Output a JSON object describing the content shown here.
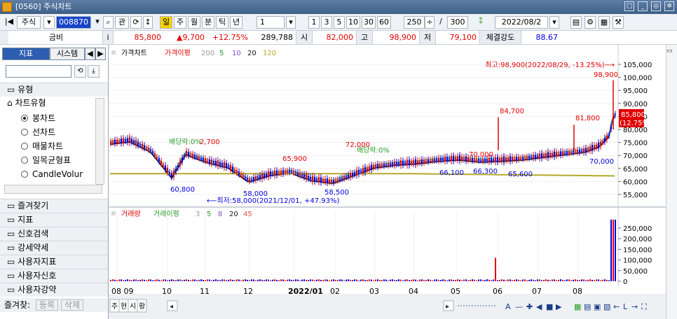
{
  "window": {
    "title": "[0560] 주식차트"
  },
  "toolbar": {
    "market": "주식",
    "code": "008870",
    "btn_gwan": "관",
    "btn_il": "일",
    "period_ju": "주",
    "period_wol": "월",
    "period_bun": "분",
    "period_tik": "틱",
    "period_nyeon": "년",
    "period_value": "1",
    "min_1": "1",
    "min_3": "3",
    "min_5": "5",
    "min_10": "10",
    "min_30": "30",
    "min_60": "60",
    "count": "250",
    "slash": "/",
    "total": "300",
    "date": "2022/08/2"
  },
  "quote": {
    "name": "금비",
    "price": "85,800",
    "change": "▲9,700",
    "change_pct": "+12.75%",
    "volume": "289,788",
    "open_label": "시",
    "open": "82,000",
    "high_label": "고",
    "high": "98,900",
    "low_label": "저",
    "low": "79,100",
    "strength_label": "체결강도",
    "strength": "88.67",
    "up_color": "#e00000",
    "down_color": "#0000e0"
  },
  "sidebar": {
    "tab_indicator": "지표",
    "tab_system": "시스템",
    "type_header": "유형",
    "chart_type_header": "차트유형",
    "chart_types": [
      "봉차트",
      "선차트",
      "매물차트",
      "일목균형표",
      "CandleVolur"
    ],
    "selected_index": 0,
    "groups": [
      "즐겨찾기",
      "지표",
      "신호검색",
      "강세약세",
      "사용자지표",
      "사용자신호",
      "사용자강약"
    ],
    "fav_label": "즐겨찾:",
    "fav_register": "등록",
    "fav_delete": "삭제"
  },
  "price_panel": {
    "legend_price": "가격차트",
    "legend_disparity": "가격이평",
    "legend_items": [
      "200",
      "5",
      "10",
      "20",
      "120"
    ],
    "legend_colors": [
      "#d9d9d9",
      "#2a9d2a",
      "#7d4ecf",
      "#111111",
      "#b5a82a"
    ],
    "y_ticks": [
      "105,000",
      "100,000",
      "95,000",
      "90,000",
      "85,000",
      "80,000",
      "75,000",
      "70,000",
      "65,000",
      "60,000",
      "55,000"
    ],
    "current_tag": "85,800",
    "current_tag_pct": "(12.75%)",
    "max_annotation": "최고:98,900(2022/08/29, -13.25%)⟶",
    "min_annotation": "⟵최저:58,000(2021/12/01, +47.93%)",
    "dividend1": "배당락:0%",
    "dividend2": "배당락:0%",
    "labels": [
      "2,700",
      "65,900",
      "72,000",
      "70,000",
      "84,700",
      "81,800",
      "98,900",
      "60,800",
      "58,000",
      "58,500",
      "66,100",
      "66,300",
      "65,600",
      "70,000"
    ]
  },
  "volume_panel": {
    "legend_volume": "거래량",
    "legend_disparity": "거래이평",
    "legend_items": [
      "3",
      "5",
      "8",
      "20",
      "45"
    ],
    "legend_colors": [
      "#d9d9d9",
      "#2a9d2a",
      "#7d4ecf",
      "#111111",
      "#e2554c"
    ],
    "y_ticks": [
      "250,000",
      "200,000",
      "150,000",
      "100,000",
      "50,000",
      "0"
    ]
  },
  "x_axis": {
    "labels": [
      "08 09",
      "10",
      "11",
      "12",
      "2022/01",
      "02",
      "03",
      "04",
      "05",
      "06",
      "07",
      "08"
    ]
  },
  "bottom_tabs": [
    "주",
    "현",
    "시",
    "황"
  ],
  "chart_data": {
    "type": "candlestick",
    "title": "가격차트",
    "y_range": [
      55000,
      105000
    ],
    "annotations": {
      "max": {
        "value": 98900,
        "date": "2022/08/29",
        "pct": "-13.25%"
      },
      "min": {
        "value": 58000,
        "date": "2021/12/01",
        "pct": "+47.93%"
      }
    },
    "last_price": 85800,
    "last_pct": "+12.75%",
    "volume_y_range": [
      0,
      250000
    ]
  }
}
